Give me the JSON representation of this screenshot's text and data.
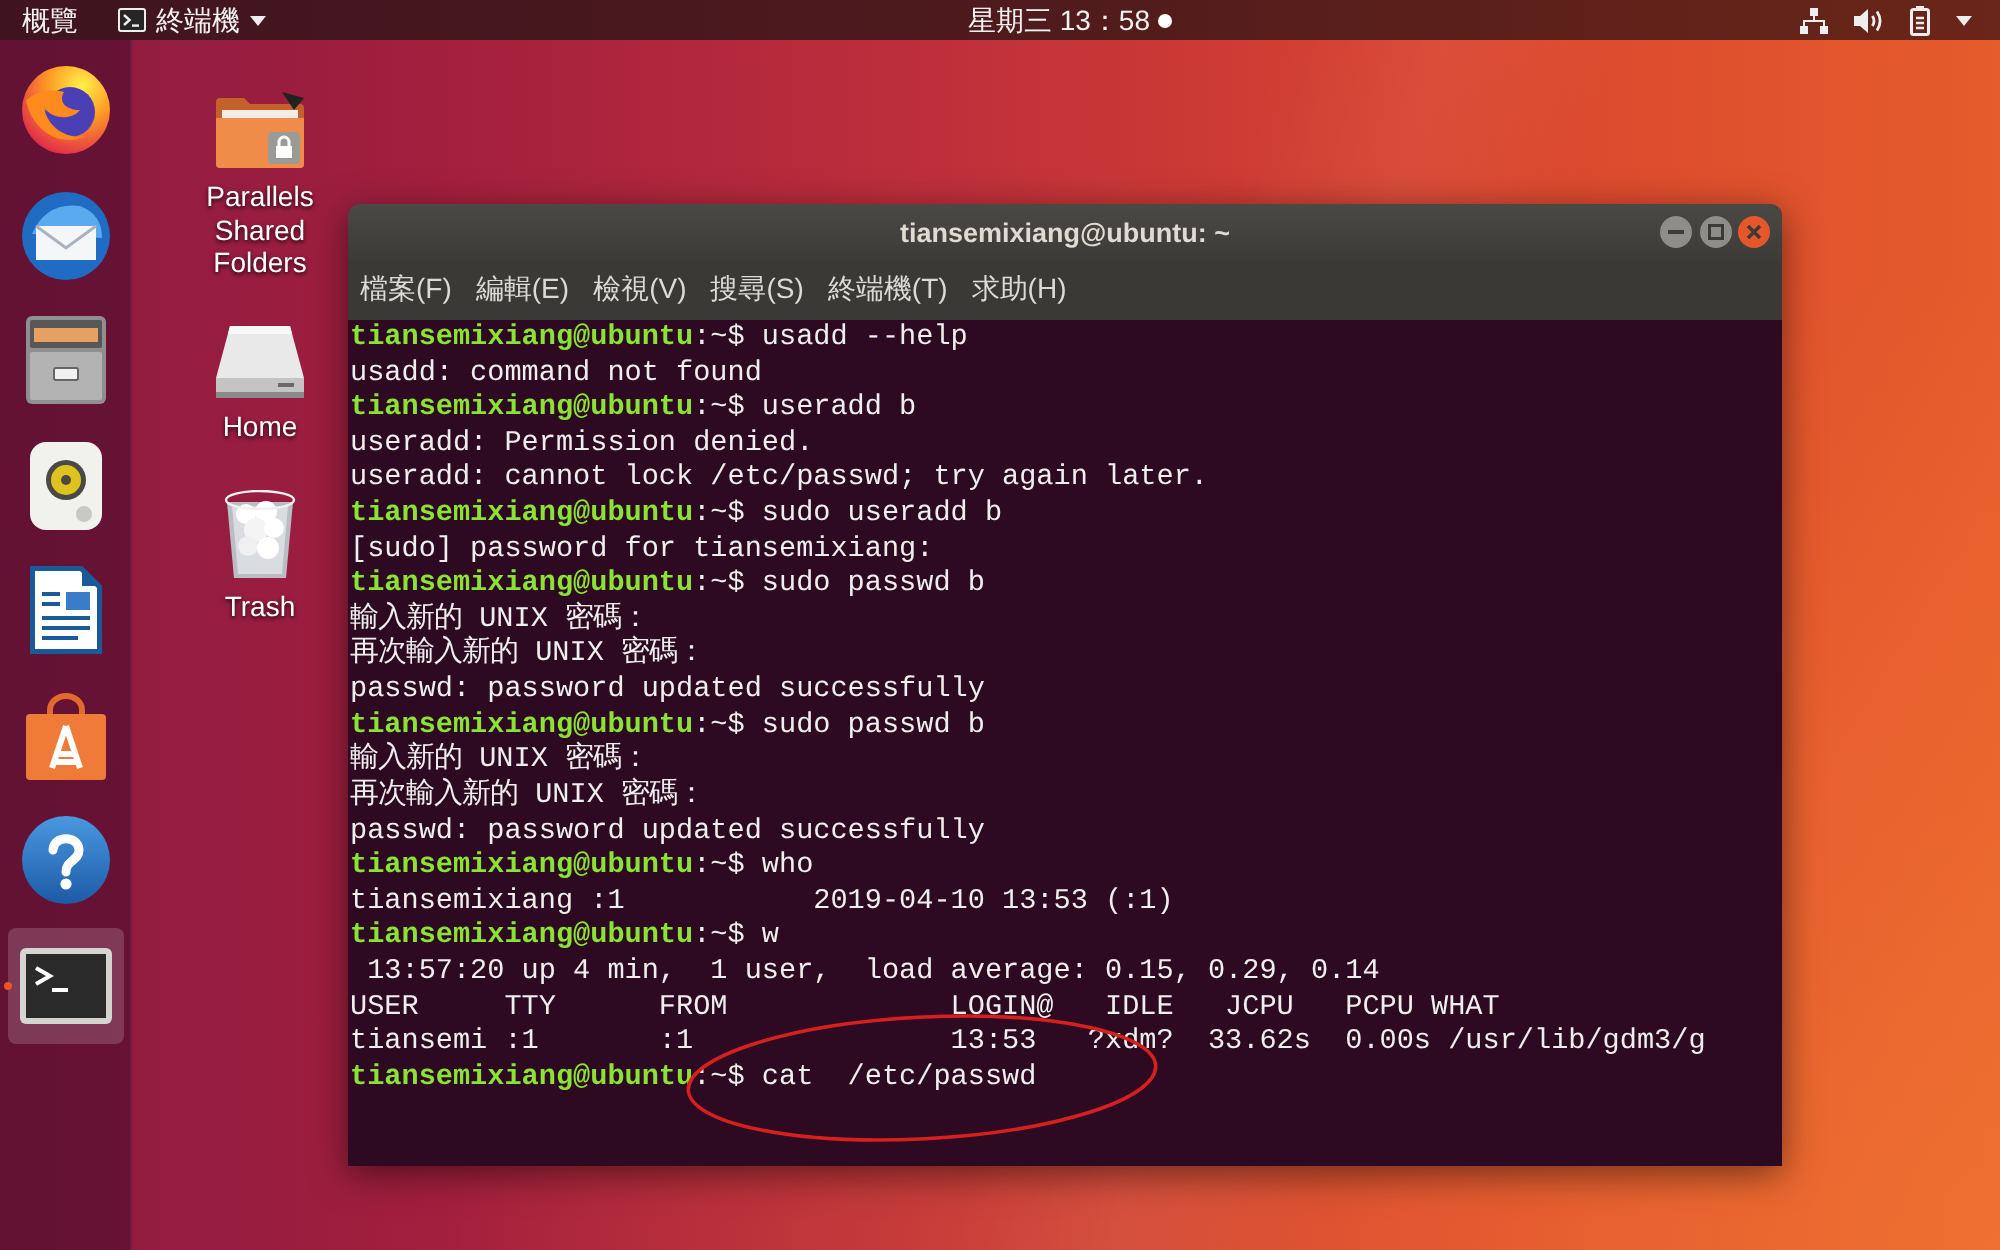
{
  "top_bar": {
    "activities": "概覽",
    "app_menu": "終端機",
    "clock": "星期三 13：58",
    "unread_notifications": true
  },
  "dock": {
    "items": [
      {
        "kind": "browser",
        "focused": false,
        "running": false
      },
      {
        "kind": "mail",
        "focused": false,
        "running": false
      },
      {
        "kind": "files",
        "focused": false,
        "running": false
      },
      {
        "kind": "music",
        "focused": false,
        "running": false
      },
      {
        "kind": "writer",
        "focused": false,
        "running": false
      },
      {
        "kind": "store",
        "focused": false,
        "running": false
      },
      {
        "kind": "help",
        "focused": false,
        "running": false
      },
      {
        "kind": "terminal",
        "focused": true,
        "running": true
      }
    ]
  },
  "desktop": {
    "icons": [
      {
        "kind": "shared-folder",
        "label": "Parallels Shared Folders"
      },
      {
        "kind": "drive",
        "label": "Home"
      },
      {
        "kind": "trash",
        "label": "Trash"
      }
    ]
  },
  "terminal": {
    "title": "tiansemixiang@ubuntu: ~",
    "menu": [
      "檔案(F)",
      "編輯(E)",
      "檢視(V)",
      "搜尋(S)",
      "終端機(T)",
      "求助(H)"
    ],
    "lines": [
      {
        "kind": "prompt",
        "prompt": "tiansemixiang@ubuntu",
        "text": ":~$ usadd --help",
        "circled": false
      },
      {
        "kind": "output",
        "text": "usadd: command not found",
        "circled": false
      },
      {
        "kind": "prompt",
        "prompt": "tiansemixiang@ubuntu",
        "text": ":~$ useradd b",
        "circled": false
      },
      {
        "kind": "output",
        "text": "useradd: Permission denied.",
        "circled": false
      },
      {
        "kind": "output",
        "text": "useradd: cannot lock /etc/passwd; try again later.",
        "circled": false
      },
      {
        "kind": "prompt",
        "prompt": "tiansemixiang@ubuntu",
        "text": ":~$ sudo useradd b",
        "circled": false
      },
      {
        "kind": "output",
        "text": "[sudo] password for tiansemixiang:",
        "circled": false
      },
      {
        "kind": "prompt",
        "prompt": "tiansemixiang@ubuntu",
        "text": ":~$ sudo passwd b",
        "circled": false
      },
      {
        "kind": "output",
        "text": "輸入新的 UNIX 密碼：",
        "circled": false
      },
      {
        "kind": "output",
        "text": "再次輸入新的 UNIX 密碼：",
        "circled": false
      },
      {
        "kind": "output",
        "text": "passwd: password updated successfully",
        "circled": false
      },
      {
        "kind": "prompt",
        "prompt": "tiansemixiang@ubuntu",
        "text": ":~$ sudo passwd b",
        "circled": false
      },
      {
        "kind": "output",
        "text": "輸入新的 UNIX 密碼：",
        "circled": false
      },
      {
        "kind": "output",
        "text": "再次輸入新的 UNIX 密碼：",
        "circled": false
      },
      {
        "kind": "output",
        "text": "passwd: password updated successfully",
        "circled": false
      },
      {
        "kind": "prompt",
        "prompt": "tiansemixiang@ubuntu",
        "text": ":~$ who",
        "circled": false
      },
      {
        "kind": "output",
        "text": "tiansemixiang :1           2019-04-10 13:53 (:1)",
        "circled": false
      },
      {
        "kind": "prompt",
        "prompt": "tiansemixiang@ubuntu",
        "text": ":~$ w",
        "circled": false
      },
      {
        "kind": "output",
        "text": " 13:57:20 up 4 min,  1 user,  load average: 0.15, 0.29, 0.14",
        "circled": false
      },
      {
        "kind": "output",
        "text": "USER     TTY      FROM             LOGIN@   IDLE   JCPU   PCPU WHAT",
        "circled": false
      },
      {
        "kind": "output",
        "text": "tiansemi :1       :1               13:53   ?xdm?  33.62s  0.00s /usr/lib/gdm3/g",
        "circled": false
      },
      {
        "kind": "prompt",
        "prompt": "tiansemixiang@ubuntu",
        "text": ":~$ cat  /etc/passwd",
        "circled": true
      }
    ]
  }
}
